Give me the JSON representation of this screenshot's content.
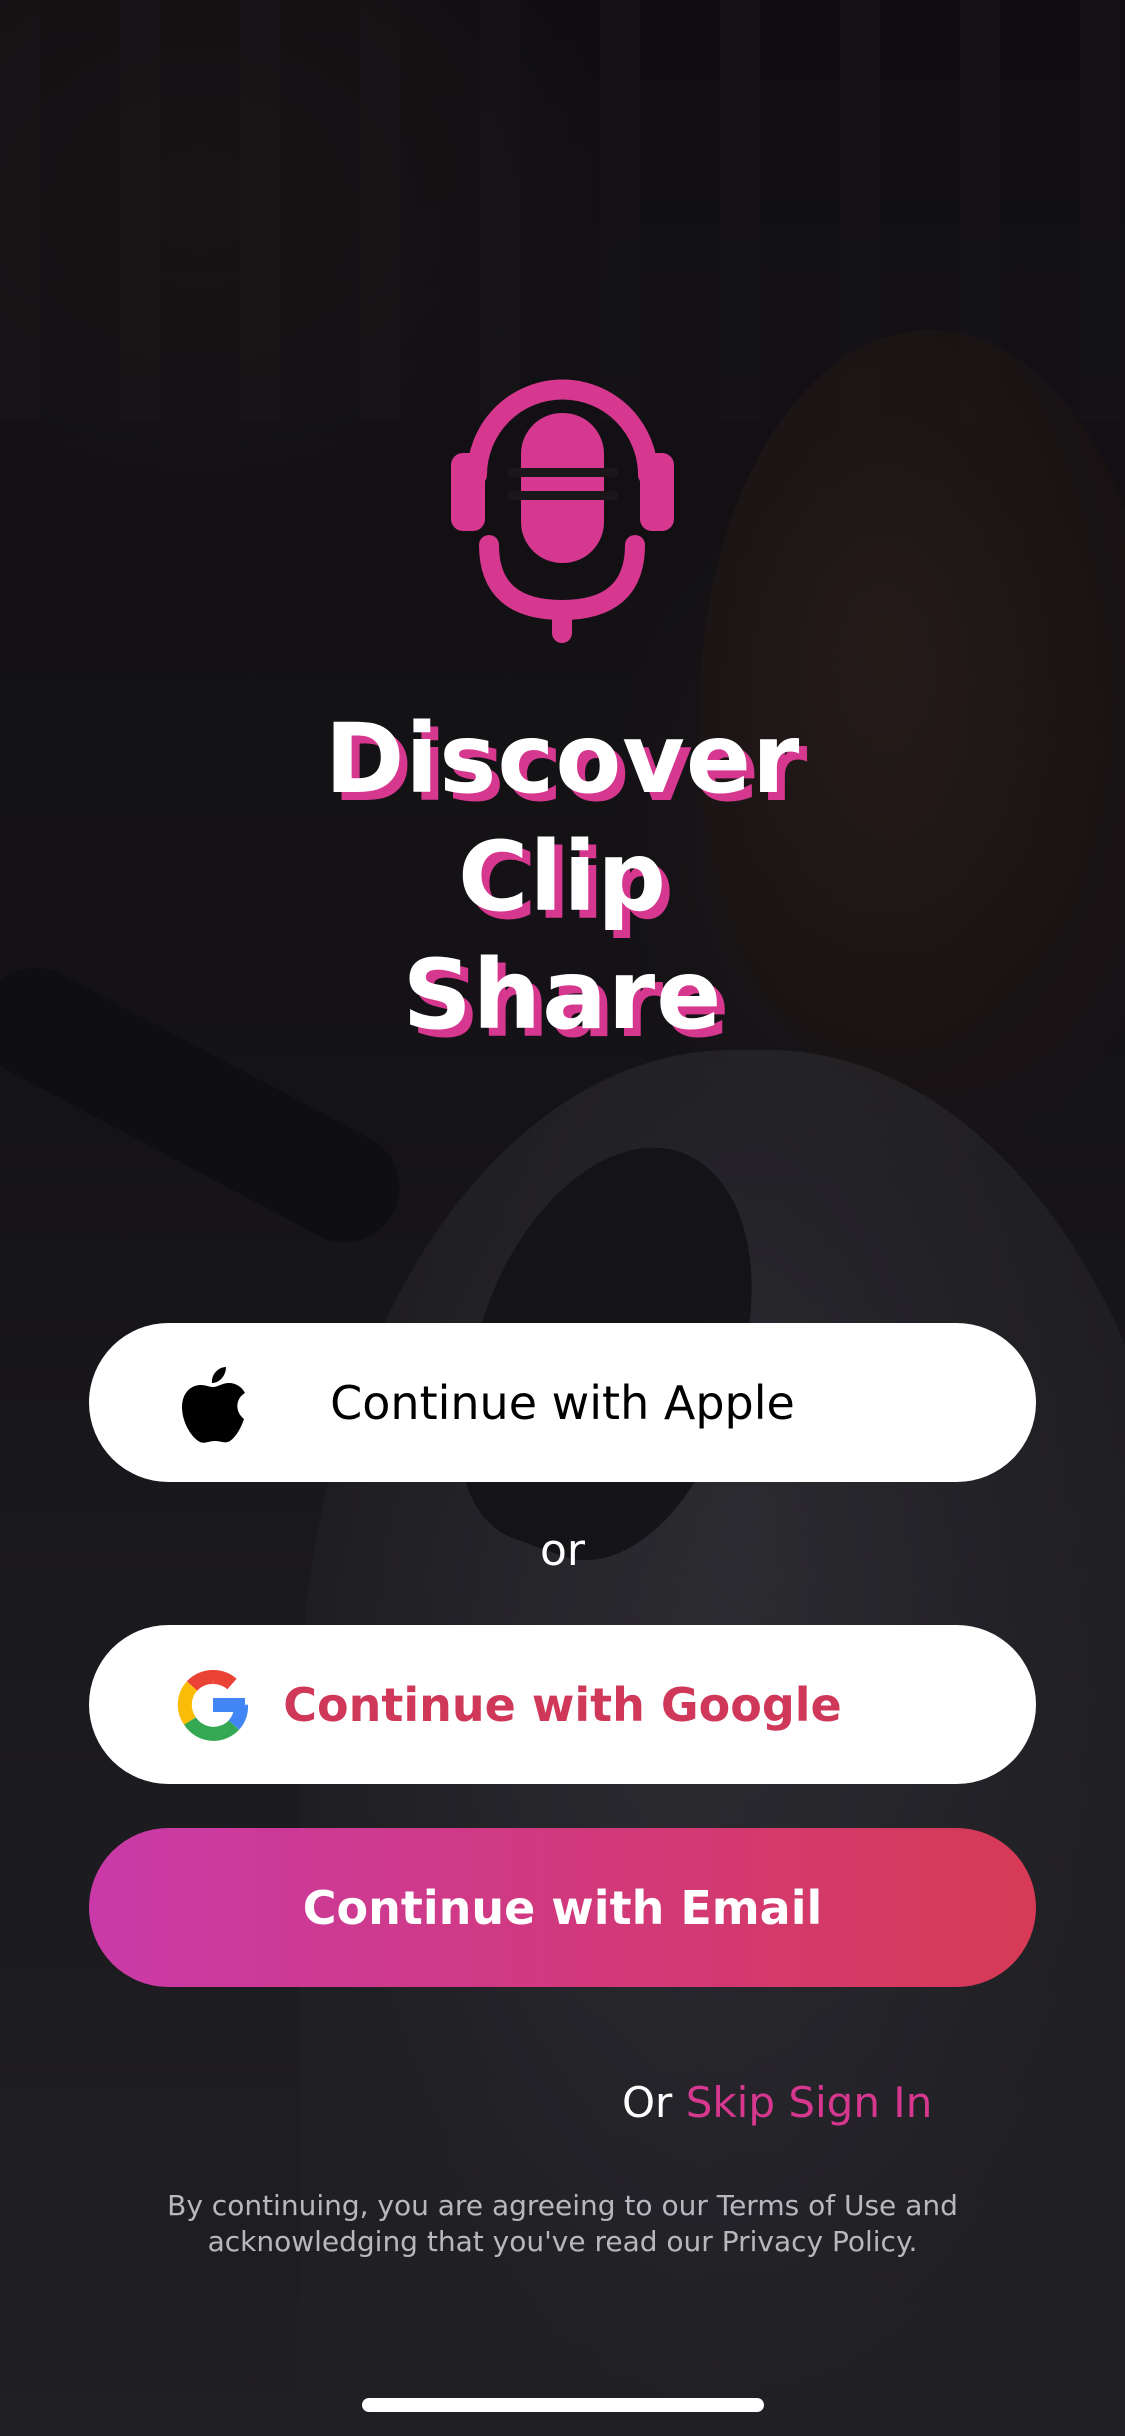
{
  "brand": {
    "logo_icon": "podcast-headphones-mic-icon",
    "accent_color": "#d6378f",
    "title_lines": [
      "Discover",
      "Clip",
      "Share"
    ]
  },
  "auth": {
    "apple": {
      "label": "Continue with Apple",
      "icon": "apple-logo-icon"
    },
    "separator": "or",
    "google": {
      "label": "Continue with Google",
      "icon": "google-logo-icon",
      "color": "#d0385a"
    },
    "email": {
      "label": "Continue with Email",
      "gradient": [
        "#c93aa8",
        "#d63a55"
      ]
    }
  },
  "skip": {
    "prefix": "Or",
    "link_label": "Skip Sign In"
  },
  "legal": {
    "line1": "By continuing, you are agreeing to our Terms of Use and",
    "line2": "acknowledging that you've read our Privacy Policy."
  }
}
